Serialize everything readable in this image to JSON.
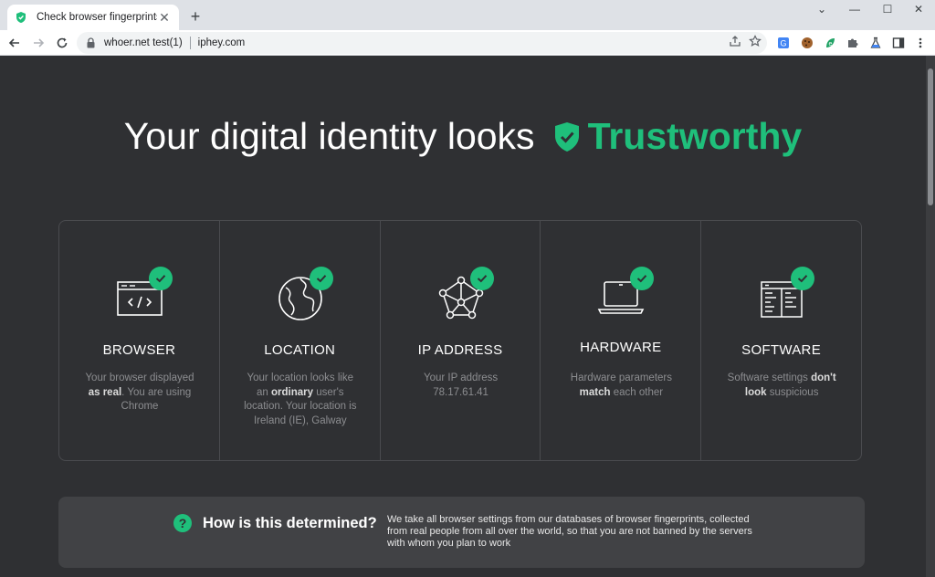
{
  "browser": {
    "tab_title": "Check browser fingerprints",
    "tab_close": "✕",
    "new_tab": "+",
    "omnibox_site": "whoer.net test(1)",
    "omnibox_url": "iphey.com",
    "win_minimize": "—",
    "win_maximize": "☐",
    "win_close": "✕",
    "tab_search": "⌄"
  },
  "hero": {
    "prefix": "Your digital identity looks",
    "status": "Trustworthy",
    "status_color": "#1fbf7b"
  },
  "cards": [
    {
      "title": "BROWSER",
      "desc_pre": "Your browser displayed ",
      "desc_bold": "as real",
      "desc_post": ". You are using Chrome"
    },
    {
      "title": "LOCATION",
      "desc_pre": "Your location looks like an ",
      "desc_bold": "ordinary",
      "desc_post": " user's location. Your location is Ireland (IE), Galway"
    },
    {
      "title": "IP ADDRESS",
      "desc_pre": "Your IP address 78.17.61.41",
      "desc_bold": "",
      "desc_post": ""
    },
    {
      "title": "HARDWARE",
      "desc_pre": "Hardware parameters ",
      "desc_bold": "match",
      "desc_post": " each other"
    },
    {
      "title": "SOFTWARE",
      "desc_pre": "Software settings ",
      "desc_bold": "don't look",
      "desc_post": " suspicious"
    }
  ],
  "info": {
    "icon": "?",
    "title": "How is this determined?",
    "text": "We take all browser settings from our databases of browser fingerprints, collected from real people from all over the world, so that you are not banned by the servers with whom you plan to work"
  },
  "icons": {
    "favicon": "shield-icon",
    "card_icons": [
      "code-window-icon",
      "globe-icon",
      "network-node-icon",
      "laptop-icon",
      "software-window-icon"
    ]
  }
}
